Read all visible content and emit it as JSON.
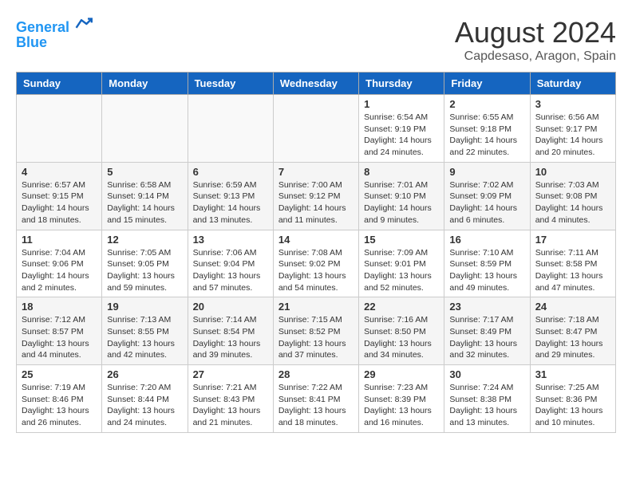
{
  "header": {
    "logo_line1": "General",
    "logo_line2": "Blue",
    "title": "August 2024",
    "subtitle": "Capdesaso, Aragon, Spain"
  },
  "weekdays": [
    "Sunday",
    "Monday",
    "Tuesday",
    "Wednesday",
    "Thursday",
    "Friday",
    "Saturday"
  ],
  "weeks": [
    [
      {
        "day": "",
        "info": ""
      },
      {
        "day": "",
        "info": ""
      },
      {
        "day": "",
        "info": ""
      },
      {
        "day": "",
        "info": ""
      },
      {
        "day": "1",
        "info": "Sunrise: 6:54 AM\nSunset: 9:19 PM\nDaylight: 14 hours\nand 24 minutes."
      },
      {
        "day": "2",
        "info": "Sunrise: 6:55 AM\nSunset: 9:18 PM\nDaylight: 14 hours\nand 22 minutes."
      },
      {
        "day": "3",
        "info": "Sunrise: 6:56 AM\nSunset: 9:17 PM\nDaylight: 14 hours\nand 20 minutes."
      }
    ],
    [
      {
        "day": "4",
        "info": "Sunrise: 6:57 AM\nSunset: 9:15 PM\nDaylight: 14 hours\nand 18 minutes."
      },
      {
        "day": "5",
        "info": "Sunrise: 6:58 AM\nSunset: 9:14 PM\nDaylight: 14 hours\nand 15 minutes."
      },
      {
        "day": "6",
        "info": "Sunrise: 6:59 AM\nSunset: 9:13 PM\nDaylight: 14 hours\nand 13 minutes."
      },
      {
        "day": "7",
        "info": "Sunrise: 7:00 AM\nSunset: 9:12 PM\nDaylight: 14 hours\nand 11 minutes."
      },
      {
        "day": "8",
        "info": "Sunrise: 7:01 AM\nSunset: 9:10 PM\nDaylight: 14 hours\nand 9 minutes."
      },
      {
        "day": "9",
        "info": "Sunrise: 7:02 AM\nSunset: 9:09 PM\nDaylight: 14 hours\nand 6 minutes."
      },
      {
        "day": "10",
        "info": "Sunrise: 7:03 AM\nSunset: 9:08 PM\nDaylight: 14 hours\nand 4 minutes."
      }
    ],
    [
      {
        "day": "11",
        "info": "Sunrise: 7:04 AM\nSunset: 9:06 PM\nDaylight: 14 hours\nand 2 minutes."
      },
      {
        "day": "12",
        "info": "Sunrise: 7:05 AM\nSunset: 9:05 PM\nDaylight: 13 hours\nand 59 minutes."
      },
      {
        "day": "13",
        "info": "Sunrise: 7:06 AM\nSunset: 9:04 PM\nDaylight: 13 hours\nand 57 minutes."
      },
      {
        "day": "14",
        "info": "Sunrise: 7:08 AM\nSunset: 9:02 PM\nDaylight: 13 hours\nand 54 minutes."
      },
      {
        "day": "15",
        "info": "Sunrise: 7:09 AM\nSunset: 9:01 PM\nDaylight: 13 hours\nand 52 minutes."
      },
      {
        "day": "16",
        "info": "Sunrise: 7:10 AM\nSunset: 8:59 PM\nDaylight: 13 hours\nand 49 minutes."
      },
      {
        "day": "17",
        "info": "Sunrise: 7:11 AM\nSunset: 8:58 PM\nDaylight: 13 hours\nand 47 minutes."
      }
    ],
    [
      {
        "day": "18",
        "info": "Sunrise: 7:12 AM\nSunset: 8:57 PM\nDaylight: 13 hours\nand 44 minutes."
      },
      {
        "day": "19",
        "info": "Sunrise: 7:13 AM\nSunset: 8:55 PM\nDaylight: 13 hours\nand 42 minutes."
      },
      {
        "day": "20",
        "info": "Sunrise: 7:14 AM\nSunset: 8:54 PM\nDaylight: 13 hours\nand 39 minutes."
      },
      {
        "day": "21",
        "info": "Sunrise: 7:15 AM\nSunset: 8:52 PM\nDaylight: 13 hours\nand 37 minutes."
      },
      {
        "day": "22",
        "info": "Sunrise: 7:16 AM\nSunset: 8:50 PM\nDaylight: 13 hours\nand 34 minutes."
      },
      {
        "day": "23",
        "info": "Sunrise: 7:17 AM\nSunset: 8:49 PM\nDaylight: 13 hours\nand 32 minutes."
      },
      {
        "day": "24",
        "info": "Sunrise: 7:18 AM\nSunset: 8:47 PM\nDaylight: 13 hours\nand 29 minutes."
      }
    ],
    [
      {
        "day": "25",
        "info": "Sunrise: 7:19 AM\nSunset: 8:46 PM\nDaylight: 13 hours\nand 26 minutes."
      },
      {
        "day": "26",
        "info": "Sunrise: 7:20 AM\nSunset: 8:44 PM\nDaylight: 13 hours\nand 24 minutes."
      },
      {
        "day": "27",
        "info": "Sunrise: 7:21 AM\nSunset: 8:43 PM\nDaylight: 13 hours\nand 21 minutes."
      },
      {
        "day": "28",
        "info": "Sunrise: 7:22 AM\nSunset: 8:41 PM\nDaylight: 13 hours\nand 18 minutes."
      },
      {
        "day": "29",
        "info": "Sunrise: 7:23 AM\nSunset: 8:39 PM\nDaylight: 13 hours\nand 16 minutes."
      },
      {
        "day": "30",
        "info": "Sunrise: 7:24 AM\nSunset: 8:38 PM\nDaylight: 13 hours\nand 13 minutes."
      },
      {
        "day": "31",
        "info": "Sunrise: 7:25 AM\nSunset: 8:36 PM\nDaylight: 13 hours\nand 10 minutes."
      }
    ]
  ]
}
